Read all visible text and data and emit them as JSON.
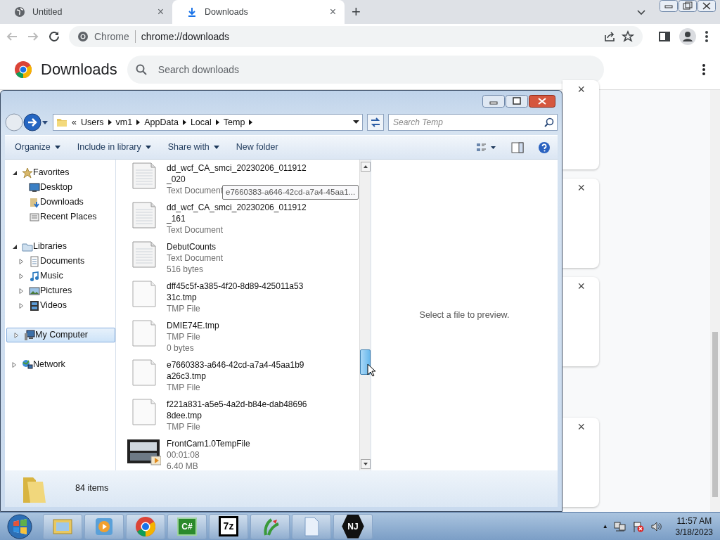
{
  "browser": {
    "tabs": [
      {
        "title": "Untitled",
        "kind": "globe",
        "close": "×",
        "selected": false
      },
      {
        "title": "Downloads",
        "kind": "download",
        "close": "×",
        "selected": true
      }
    ],
    "new_tab": "+",
    "omnibox": {
      "site_label": "Chrome",
      "url": "chrome://downloads"
    },
    "page": {
      "title": "Downloads",
      "search": {
        "placeholder": "Search downloads"
      }
    },
    "download_cards": [
      {
        "close": "×"
      },
      {
        "close": "×"
      },
      {
        "close": "×"
      },
      {
        "close": "×"
      }
    ]
  },
  "explorer": {
    "breadcrumb_overflow": "«",
    "breadcrumb": [
      "Users",
      "vm1",
      "AppData",
      "Local",
      "Temp"
    ],
    "search": {
      "placeholder": "Search Temp"
    },
    "commands": [
      {
        "label": "Organize",
        "dropdown": true
      },
      {
        "label": "Include in library",
        "dropdown": true
      },
      {
        "label": "Share with",
        "dropdown": true
      },
      {
        "label": "New folder",
        "dropdown": false
      }
    ],
    "navigation": [
      {
        "label": "Favorites",
        "kind": "star",
        "expanded": true,
        "selected": false,
        "children": [
          {
            "label": "Desktop",
            "kind": "desktop",
            "selected": false
          },
          {
            "label": "Downloads",
            "kind": "downloads",
            "selected": false
          },
          {
            "label": "Recent Places",
            "kind": "recent",
            "selected": false
          }
        ]
      },
      {
        "label": "Libraries",
        "kind": "library",
        "expanded": true,
        "selected": false,
        "children": [
          {
            "label": "Documents",
            "kind": "documents",
            "expanded": false,
            "selected": false
          },
          {
            "label": "Music",
            "kind": "music",
            "expanded": false,
            "selected": false
          },
          {
            "label": "Pictures",
            "kind": "pictures",
            "expanded": false,
            "selected": false
          },
          {
            "label": "Videos",
            "kind": "videos",
            "expanded": false,
            "selected": false
          }
        ]
      },
      {
        "label": "My Computer",
        "kind": "computer",
        "expanded": false,
        "selected": true
      },
      {
        "label": "Network",
        "kind": "network",
        "expanded": false,
        "selected": false
      }
    ],
    "files": [
      {
        "name": "dd_wcf_CA_smci_20230206_011912_020",
        "kind": "text",
        "details": [
          "Text Document"
        ]
      },
      {
        "name": "dd_wcf_CA_smci_20230206_011912_161",
        "kind": "text",
        "details": [
          "Text Document"
        ]
      },
      {
        "name": "DebutCounts",
        "kind": "text",
        "details": [
          "Text Document",
          "516 bytes"
        ]
      },
      {
        "name": "dff45c5f-a385-4f20-8d89-425011a5331c.tmp",
        "kind": "tmp",
        "details": [
          "TMP File"
        ]
      },
      {
        "name": "DMIE74E.tmp",
        "kind": "tmp",
        "details": [
          "TMP File",
          "0 bytes"
        ]
      },
      {
        "name": "e7660383-a646-42cd-a7a4-45aa1b9a26c3.tmp",
        "kind": "tmp",
        "details": [
          "TMP File"
        ]
      },
      {
        "name": "f221a831-a5e5-4a2d-b84e-dab486968dee.tmp",
        "kind": "tmp",
        "details": [
          "TMP File"
        ]
      },
      {
        "name": "FrontCam1.0TempFile",
        "kind": "video",
        "details": [
          "00:01:08",
          "6.40 MB"
        ]
      }
    ],
    "tooltip": "e7660383-a646-42cd-a7a4-45aa1...",
    "preview_message": "Select a file to preview.",
    "item_count": "84 items"
  },
  "taskbar": {
    "apps": [
      {
        "kind": "explorer"
      },
      {
        "kind": "player"
      },
      {
        "kind": "chrome"
      },
      {
        "kind": "csharp",
        "glyph": "C#"
      },
      {
        "kind": "sevenzip",
        "glyph": "7z"
      },
      {
        "kind": "plant"
      },
      {
        "kind": "file"
      },
      {
        "kind": "hexagon",
        "glyph": "NJ"
      }
    ],
    "tray_expand": "▲",
    "time": "11:57 AM",
    "date": "3/18/2023"
  }
}
